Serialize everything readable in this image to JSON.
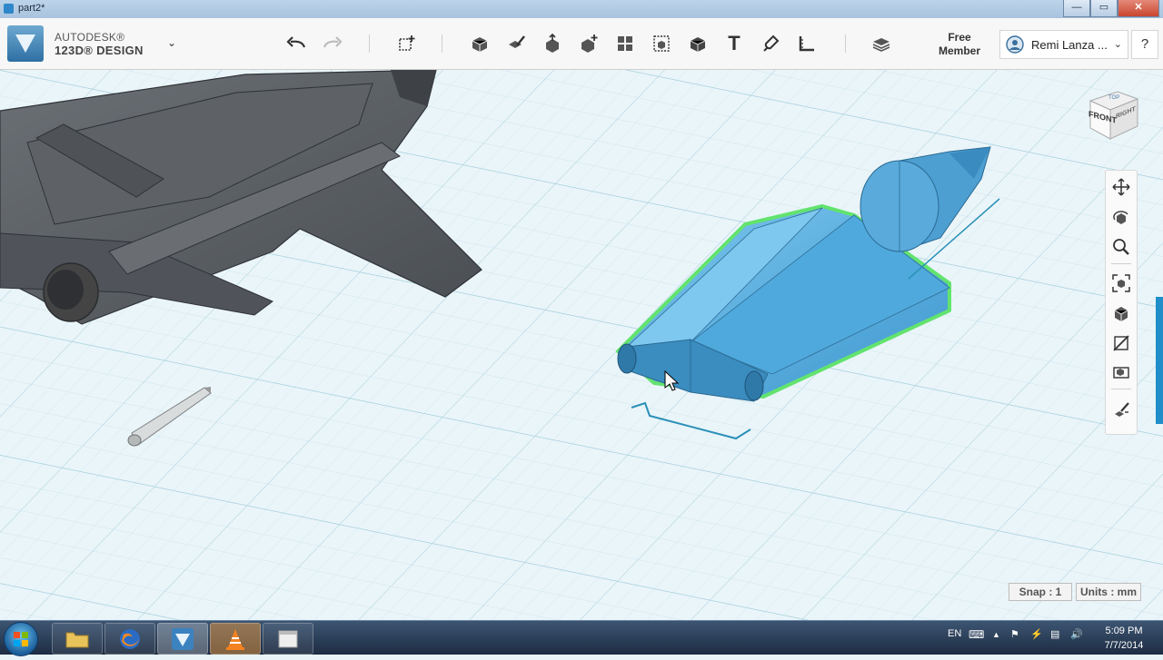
{
  "window": {
    "title": "part2*",
    "controls": [
      "—",
      "▭",
      "✕"
    ]
  },
  "toolbar": {
    "brand_line1": "AUTODESK®",
    "brand_line2": "123D® DESIGN",
    "undo_icon": "undo-arrow-icon",
    "redo_icon": "redo-arrow-icon",
    "tools": [
      "transform",
      "primitives",
      "sketch",
      "construct",
      "modify",
      "pattern",
      "grouping",
      "combine",
      "measure",
      "text",
      "snap",
      "ruler",
      "materials"
    ],
    "text_tool_label": "T",
    "membership": "Free Member",
    "user_name": "Remi Lanza ...",
    "help_label": "?"
  },
  "viewcube": {
    "front_label": "FRONT",
    "right_label": "RIGHT",
    "top_label": "TOP"
  },
  "status": {
    "snap": "Snap : 1",
    "units": "Units : mm"
  },
  "taskbar": {
    "lang": "EN",
    "time": "5:09 PM",
    "date": "7/7/2014",
    "apps": [
      "explorer",
      "firefox",
      "123d-design",
      "vlc",
      "window"
    ]
  },
  "colors": {
    "grid_bg": "#e9f4f8",
    "grid_line": "#c0dde8",
    "selected_body": "#58b0e2",
    "selection_outline": "#62e36e",
    "aircraft": "#5a5e63"
  }
}
